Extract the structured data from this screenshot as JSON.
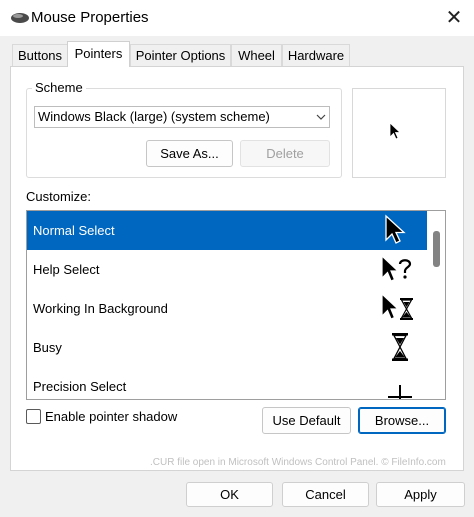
{
  "window": {
    "title": "Mouse Properties",
    "app_icon": "mouse-icon",
    "close_glyph": "✕"
  },
  "tabs": [
    {
      "label": "Buttons",
      "active": false
    },
    {
      "label": "Pointers",
      "active": true
    },
    {
      "label": "Pointer Options",
      "active": false
    },
    {
      "label": "Wheel",
      "active": false
    },
    {
      "label": "Hardware",
      "active": false
    }
  ],
  "scheme": {
    "group_label": "Scheme",
    "selected": "Windows Black (large) (system scheme)",
    "save_as_label": "Save As...",
    "delete_label": "Delete",
    "delete_enabled": false
  },
  "customize": {
    "label": "Customize:",
    "items": [
      {
        "label": "Normal Select",
        "icon": "arrow-cursor-icon",
        "selected": true
      },
      {
        "label": "Help Select",
        "icon": "help-cursor-icon",
        "selected": false
      },
      {
        "label": "Working In Background",
        "icon": "working-cursor-icon",
        "selected": false
      },
      {
        "label": "Busy",
        "icon": "hourglass-icon",
        "selected": false
      },
      {
        "label": "Precision Select",
        "icon": "crosshair-icon",
        "selected": false
      }
    ]
  },
  "shadow": {
    "label": "Enable pointer shadow",
    "checked": false
  },
  "buttons": {
    "use_default": "Use Default",
    "browse": "Browse..."
  },
  "watermark": ".CUR file open in Microsoft Windows Control Panel. © FileInfo.com",
  "footer": {
    "ok": "OK",
    "cancel": "Cancel",
    "apply": "Apply"
  },
  "colors": {
    "selection": "#0067c0",
    "focus": "#0067c0"
  }
}
